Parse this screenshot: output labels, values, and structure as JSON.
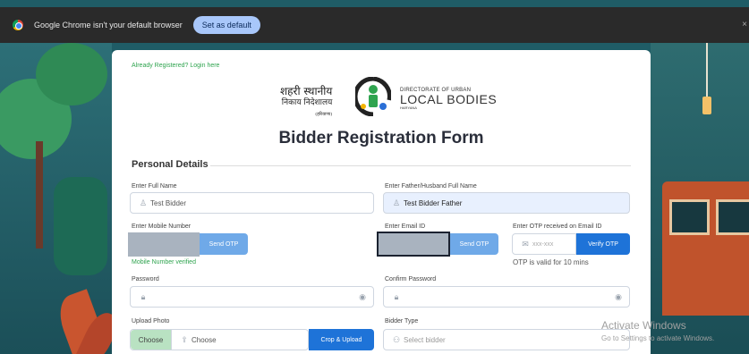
{
  "browser": {
    "infobar_text": "Google Chrome isn't your default browser",
    "set_default_label": "Set as default",
    "close_glyph": "×"
  },
  "form": {
    "already_registered": "Already Registered? Login here",
    "logo": {
      "hindi_line1": "शहरी स्थानीय",
      "hindi_line2": "निकाय निदेशालय",
      "hindi_line3": "(हरियाणा)",
      "en_line1": "DIRECTORATE OF URBAN",
      "en_line2": "LOCAL BODIES",
      "en_line3": "HARYANA"
    },
    "title": "Bidder Registration Form",
    "section_title": "Personal Details",
    "full_name": {
      "label": "Enter Full Name",
      "value": "Test Bidder"
    },
    "father_name": {
      "label": "Enter Father/Husband Full Name",
      "value": "Test Bidder Father"
    },
    "mobile": {
      "label": "Enter Mobile Number",
      "send_otp": "Send OTP",
      "status": "Mobile Number verified"
    },
    "email": {
      "label": "Enter Email ID",
      "send_otp": "Send OTP"
    },
    "email_otp": {
      "label": "Enter OTP received on Email ID",
      "placeholder": "xxx-xxx",
      "verify": "Verify OTP",
      "validity": "OTP is valid for 10 mins"
    },
    "password": {
      "label": "Password"
    },
    "confirm_password": {
      "label": "Confirm Password"
    },
    "photo": {
      "label": "Upload Photo",
      "choose_btn": "Choose",
      "choose_text": "Choose",
      "crop_upload": "Crop & Upload"
    },
    "bidder_type": {
      "label": "Bidder Type",
      "placeholder": "Select bidder"
    }
  },
  "watermark": {
    "line1": "Activate Windows",
    "line2": "Go to Settings to activate Windows."
  },
  "colors": {
    "accent": "#1e73d8",
    "success": "#2fa44f",
    "infobar": "#2a2a2a"
  },
  "icons": [
    "chrome-icon",
    "user-icon",
    "envelope-icon",
    "lock-icon",
    "eye-icon",
    "upload-icon",
    "bidder-icon"
  ]
}
